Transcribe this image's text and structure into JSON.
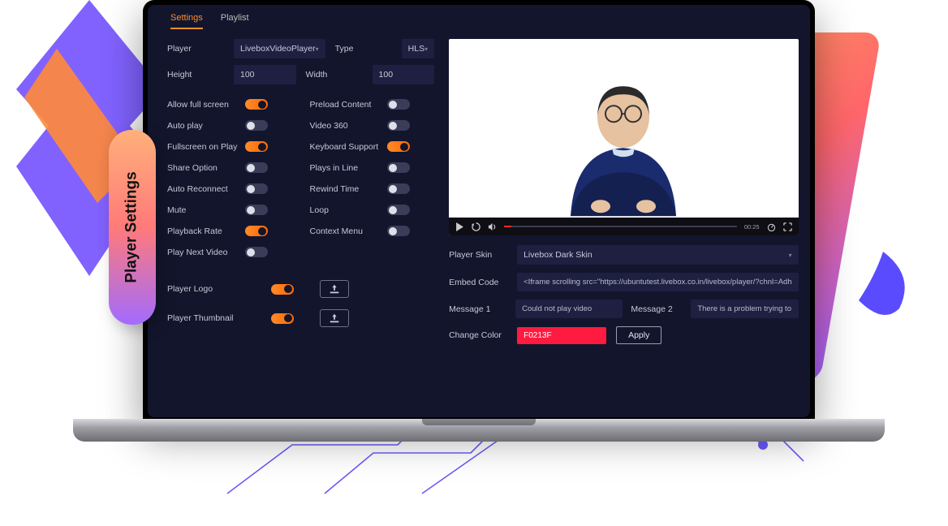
{
  "badge_title": "Player Settings",
  "tabs": {
    "settings": "Settings",
    "playlist": "Playlist"
  },
  "fields": {
    "player_lbl": "Player",
    "player_val": "LiveboxVideoPlayer",
    "type_lbl": "Type",
    "type_val": "HLS",
    "height_lbl": "Height",
    "height_val": "100",
    "width_lbl": "Width",
    "width_val": "100"
  },
  "toggles": [
    {
      "label": "Allow full screen",
      "on": true
    },
    {
      "label": "Preload Content",
      "on": false
    },
    {
      "label": "Auto play",
      "on": false
    },
    {
      "label": "Video 360",
      "on": false
    },
    {
      "label": "Fullscreen on Play",
      "on": true
    },
    {
      "label": "Keyboard Support",
      "on": true
    },
    {
      "label": "Share Option",
      "on": false
    },
    {
      "label": "Plays in Line",
      "on": false
    },
    {
      "label": "Auto Reconnect",
      "on": false
    },
    {
      "label": "Rewind Time",
      "on": false
    },
    {
      "label": "Mute",
      "on": false
    },
    {
      "label": "Loop",
      "on": false
    },
    {
      "label": "Playback Rate",
      "on": true
    },
    {
      "label": "Context Menu",
      "on": false
    },
    {
      "label": "Play Next Video",
      "on": false
    }
  ],
  "logo_lbl": "Player Logo",
  "thumb_lbl": "Player Thumbnail",
  "preview": {
    "time": "00:25"
  },
  "right": {
    "skin_lbl": "Player Skin",
    "skin_val": "Livebox Dark Skin",
    "embed_lbl": "Embed Code",
    "embed_val": "<Iframe scrolling src=\"https://ubuntutest.livebox.co.in/livebox/player/?chnl=Adh",
    "msg1_lbl": "Message 1",
    "msg1_val": "Could not play video",
    "msg2_lbl": "Message 2",
    "msg2_val": "There is a problem trying to",
    "color_lbl": "Change Color",
    "color_val": "F0213F",
    "apply": "Apply"
  }
}
